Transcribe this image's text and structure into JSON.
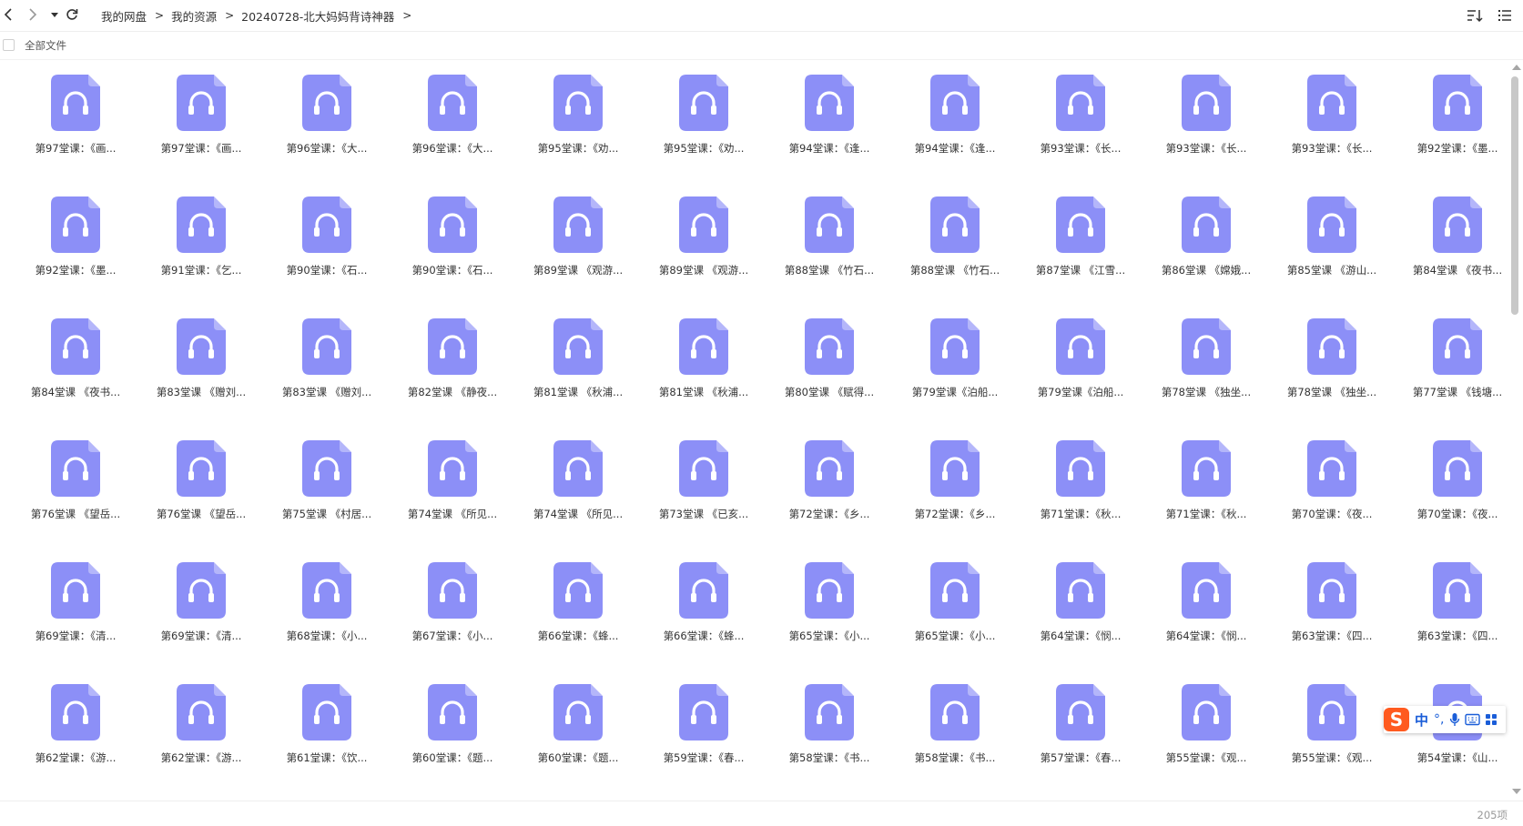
{
  "breadcrumb": [
    "我的网盘",
    "我的资源",
    "20240728-北大妈妈背诗神器"
  ],
  "breadcrumb_separator": ">",
  "select_all_label": "全部文件",
  "item_count": "205项",
  "icon_color": "#8c8ff7",
  "files": [
    "第97堂课：《画...",
    "第97堂课：《画...",
    "第96堂课：《大...",
    "第96堂课：《大...",
    "第95堂课：《劝...",
    "第95堂课：《劝...",
    "第94堂课：《逢...",
    "第94堂课：《逢...",
    "第93堂课：《长...",
    "第93堂课：《长...",
    "第93堂课：《长...",
    "第92堂课：《墨...",
    "第92堂课：《墨...",
    "第91堂课：《乞...",
    "第90堂课：《石...",
    "第90堂课：《石...",
    "第89堂课 《观游...",
    "第89堂课 《观游...",
    "第88堂课 《竹石...",
    "第88堂课 《竹石...",
    "第87堂课 《江雪...",
    "第86堂课 《嫦娥...",
    "第85堂课 《游山...",
    "第84堂课 《夜书...",
    "第84堂课 《夜书...",
    "第83堂课 《赠刘...",
    "第83堂课 《赠刘...",
    "第82堂课 《静夜...",
    "第81堂课 《秋浦...",
    "第81堂课 《秋浦...",
    "第80堂课 《赋得...",
    "第79堂课《泊船...",
    "第79堂课《泊船...",
    "第78堂课 《独坐...",
    "第78堂课 《独坐...",
    "第77堂课 《钱塘...",
    "第76堂课 《望岳...",
    "第76堂课 《望岳...",
    "第75堂课 《村居...",
    "第74堂课 《所见...",
    "第74堂课 《所见...",
    "第73堂课 《已亥...",
    "第72堂课：《乡...",
    "第72堂课：《乡...",
    "第71堂课：《秋...",
    "第71堂课：《秋...",
    "第70堂课：《夜...",
    "第70堂课：《夜...",
    "第69堂课：《清...",
    "第69堂课：《清...",
    "第68堂课：《小...",
    "第67堂课：《小...",
    "第66堂课：《蜂...",
    "第66堂课：《蜂...",
    "第65堂课：《小...",
    "第65堂课：《小...",
    "第64堂课：《悯...",
    "第64堂课：《悯...",
    "第63堂课：《四...",
    "第63堂课：《四...",
    "第62堂课：《游...",
    "第62堂课：《游...",
    "第61堂课：《饮...",
    "第60堂课：《题...",
    "第60堂课：《题...",
    "第59堂课：《春...",
    "第58堂课：《书...",
    "第58堂课：《书...",
    "第57堂课：《春...",
    "第55堂课：《观...",
    "第55堂课：《观...",
    "第54堂课：《山..."
  ],
  "ime": {
    "lang": "中",
    "punct": "°,"
  }
}
